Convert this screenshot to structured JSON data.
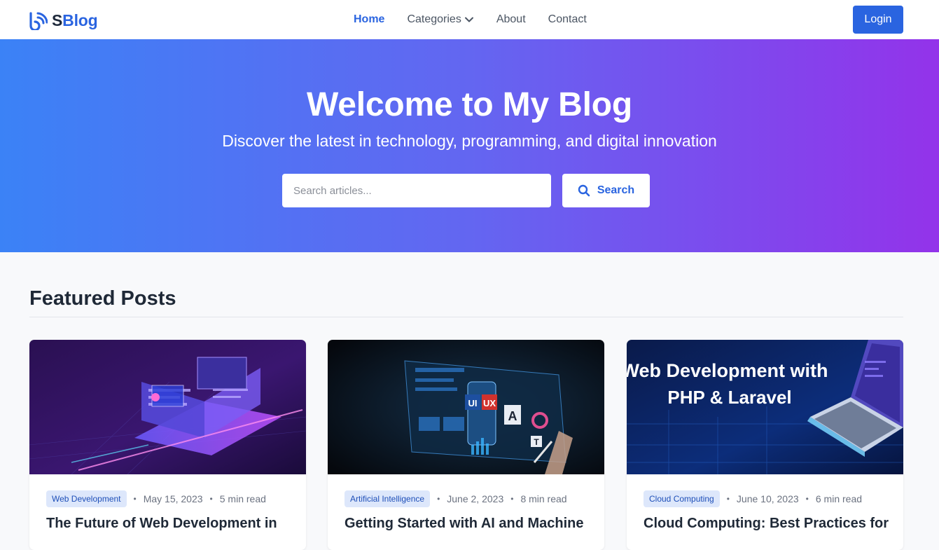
{
  "brand": {
    "name_s": "S",
    "name_rest": "Blog",
    "icon": "wifi-b-logo-icon",
    "color": "#2a64e0"
  },
  "nav": {
    "links": [
      {
        "label": "Home",
        "active": true
      },
      {
        "label": "Categories",
        "icon": "chevron-down-icon"
      },
      {
        "label": "About"
      },
      {
        "label": "Contact"
      }
    ],
    "login_label": "Login"
  },
  "hero": {
    "title": "Welcome to My Blog",
    "subtitle": "Discover the latest in technology, programming, and digital innovation",
    "search_placeholder": "Search articles...",
    "search_label": "Search",
    "search_icon": "search-icon",
    "gradient": [
      "#3b82f6",
      "#6366f1",
      "#9333ea"
    ]
  },
  "featured": {
    "title": "Featured Posts",
    "posts": [
      {
        "category": "Web Development",
        "date": "May 15, 2023",
        "read_time": "5 min read",
        "title": "The Future of Web Development in"
      },
      {
        "category": "Artificial Intelligence",
        "date": "June 2, 2023",
        "read_time": "8 min read",
        "title": "Getting Started with AI and Machine",
        "image_labels": {
          "ui": "UI",
          "ux": "UX",
          "a": "A",
          "t": "T"
        }
      },
      {
        "category": "Cloud Computing",
        "date": "June 10, 2023",
        "read_time": "6 min read",
        "title": "Cloud Computing: Best Practices for",
        "image_text_line1": "Web Development with",
        "image_text_line2": "PHP & Laravel"
      }
    ]
  }
}
